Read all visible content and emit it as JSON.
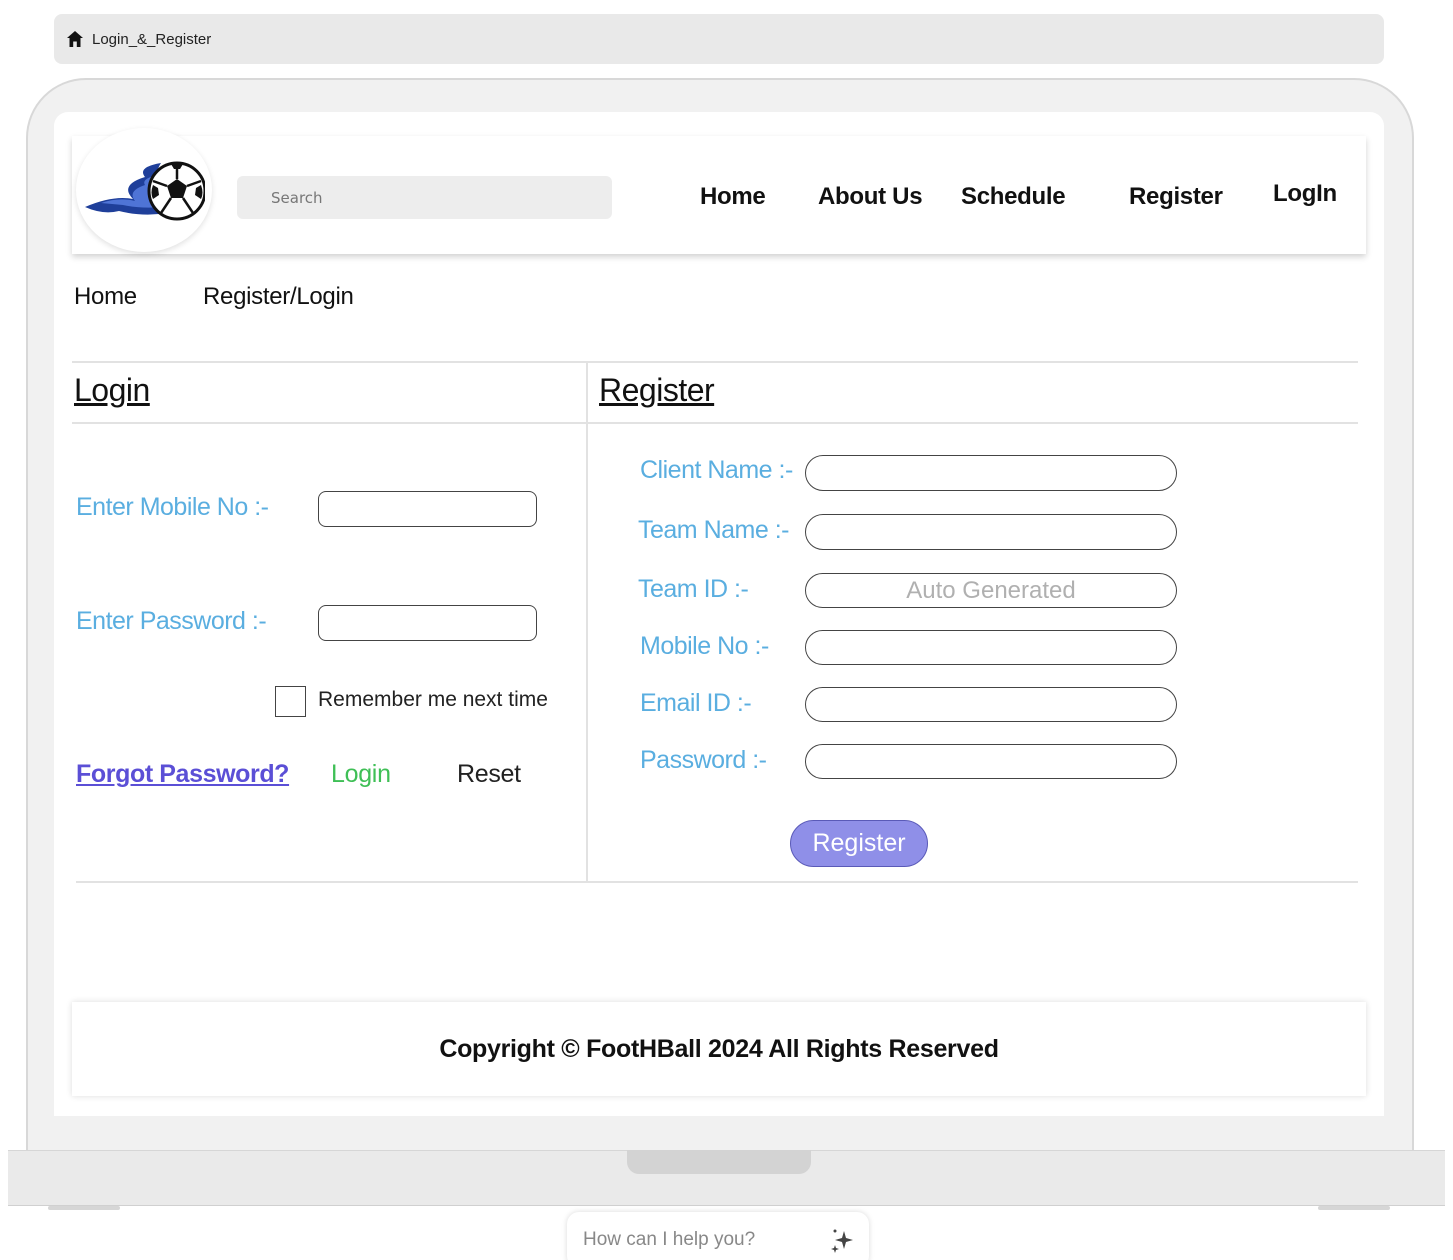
{
  "breadcrumb_bar": {
    "icon": "home-icon",
    "title": "Login_&_Register"
  },
  "header": {
    "search_placeholder": "Search",
    "nav": [
      "Home",
      "About Us",
      "Schedule",
      "Register",
      "LogIn"
    ]
  },
  "breadcrumb": [
    "Home",
    "Register/Login"
  ],
  "login": {
    "title": "Login",
    "mobile_label": "Enter Mobile No :-",
    "password_label": "Enter Password :-",
    "remember_label": "Remember me next time",
    "forgot": "Forgot Password?",
    "login_button": "Login",
    "reset_button": "Reset"
  },
  "register": {
    "title": "Register",
    "fields": [
      {
        "label": "Client Name :-",
        "placeholder": ""
      },
      {
        "label": "Team Name :-",
        "placeholder": ""
      },
      {
        "label": "Team ID :-",
        "placeholder": "Auto Generated"
      },
      {
        "label": "Mobile No :-",
        "placeholder": ""
      },
      {
        "label": "Email ID :-",
        "placeholder": ""
      },
      {
        "label": "Password :-",
        "placeholder": ""
      }
    ],
    "button": "Register"
  },
  "footer": {
    "text": "Copyright © FootHBall 2024 All Rights Reserved"
  },
  "chat": {
    "placeholder": "How can I help you?",
    "icon": "sparkle-icon"
  },
  "colors": {
    "label_blue": "#5aaee0",
    "link_purple": "#5b4fd6",
    "login_green": "#3fbf56",
    "register_btn": "#8f8fe8"
  }
}
